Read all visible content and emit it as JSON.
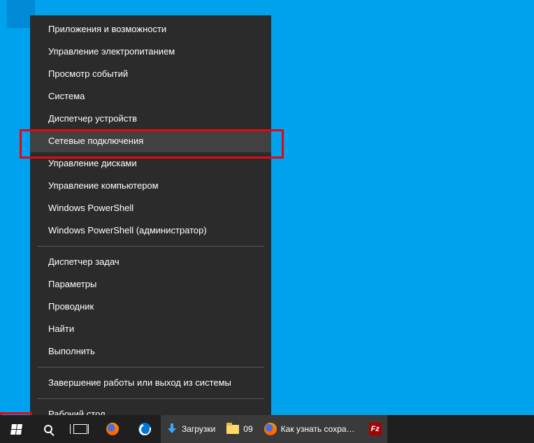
{
  "winx_menu": {
    "groups": [
      [
        "Приложения и возможности",
        "Управление электропитанием",
        "Просмотр событий",
        "Система",
        "Диспетчер устройств",
        "Сетевые подключения",
        "Управление дисками",
        "Управление компьютером",
        "Windows PowerShell",
        "Windows PowerShell (администратор)"
      ],
      [
        "Диспетчер задач",
        "Параметры",
        "Проводник",
        "Найти",
        "Выполнить"
      ],
      [
        "Завершение работы или выход из системы"
      ],
      [
        "Рабочий стол"
      ]
    ],
    "hovered_label": "Сетевые подключения"
  },
  "taskbar": {
    "apps": [
      {
        "icon": "dl-ico",
        "label": "Загрузки"
      },
      {
        "icon": "folder-ico",
        "label": "09"
      },
      {
        "icon": "ff-ico",
        "label": "Как узнать сохран..."
      },
      {
        "icon": "fz-ico",
        "label": ""
      }
    ]
  }
}
